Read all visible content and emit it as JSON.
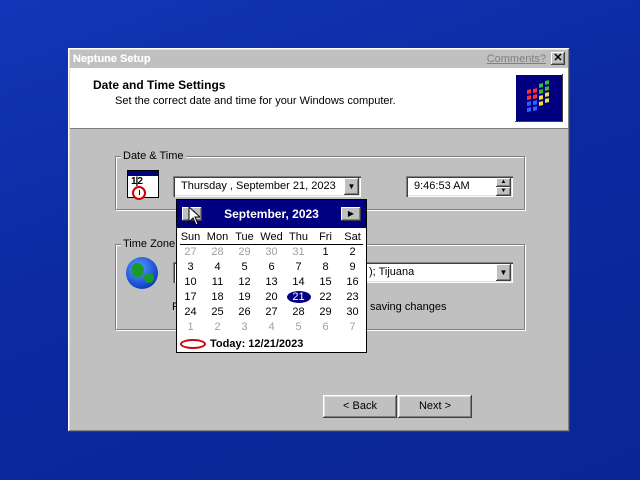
{
  "window": {
    "title": "Neptune Setup",
    "comments_link": "Comments?",
    "close_glyph": "✕"
  },
  "header": {
    "title": "Date and Time Settings",
    "subtitle": "Set the correct date and time for your Windows computer."
  },
  "date_time_group": {
    "label": "Date & Time",
    "date_value": "Thursday  , September 21, 2023",
    "time_value": "9:46:53 AM"
  },
  "time_zone_group": {
    "label": "Time Zone",
    "selected_partial": "); Tijuana",
    "daylight_prefix": "R",
    "daylight_suffix": "saving changes"
  },
  "calendar": {
    "month_label": "September, 2023",
    "days_of_week": [
      "Sun",
      "Mon",
      "Tue",
      "Wed",
      "Thu",
      "Fri",
      "Sat"
    ],
    "weeks": [
      [
        "27",
        "28",
        "29",
        "30",
        "31",
        "1",
        "2"
      ],
      [
        "3",
        "4",
        "5",
        "6",
        "7",
        "8",
        "9"
      ],
      [
        "10",
        "11",
        "12",
        "13",
        "14",
        "15",
        "16"
      ],
      [
        "17",
        "18",
        "19",
        "20",
        "21",
        "22",
        "23"
      ],
      [
        "24",
        "25",
        "26",
        "27",
        "28",
        "29",
        "30"
      ],
      [
        "1",
        "2",
        "3",
        "4",
        "5",
        "6",
        "7"
      ]
    ],
    "selected_day": "21",
    "today_label": "Today: 12/21/2023"
  },
  "buttons": {
    "back": "< Back",
    "next": "Next >"
  },
  "colors": {
    "desktop": "#0a2aa6",
    "title_selection": "#000080",
    "today_ring": "#d00000"
  },
  "icons": {
    "calendar": "calendar-icon",
    "globe": "globe-icon",
    "logo": "windows-logo-icon"
  }
}
